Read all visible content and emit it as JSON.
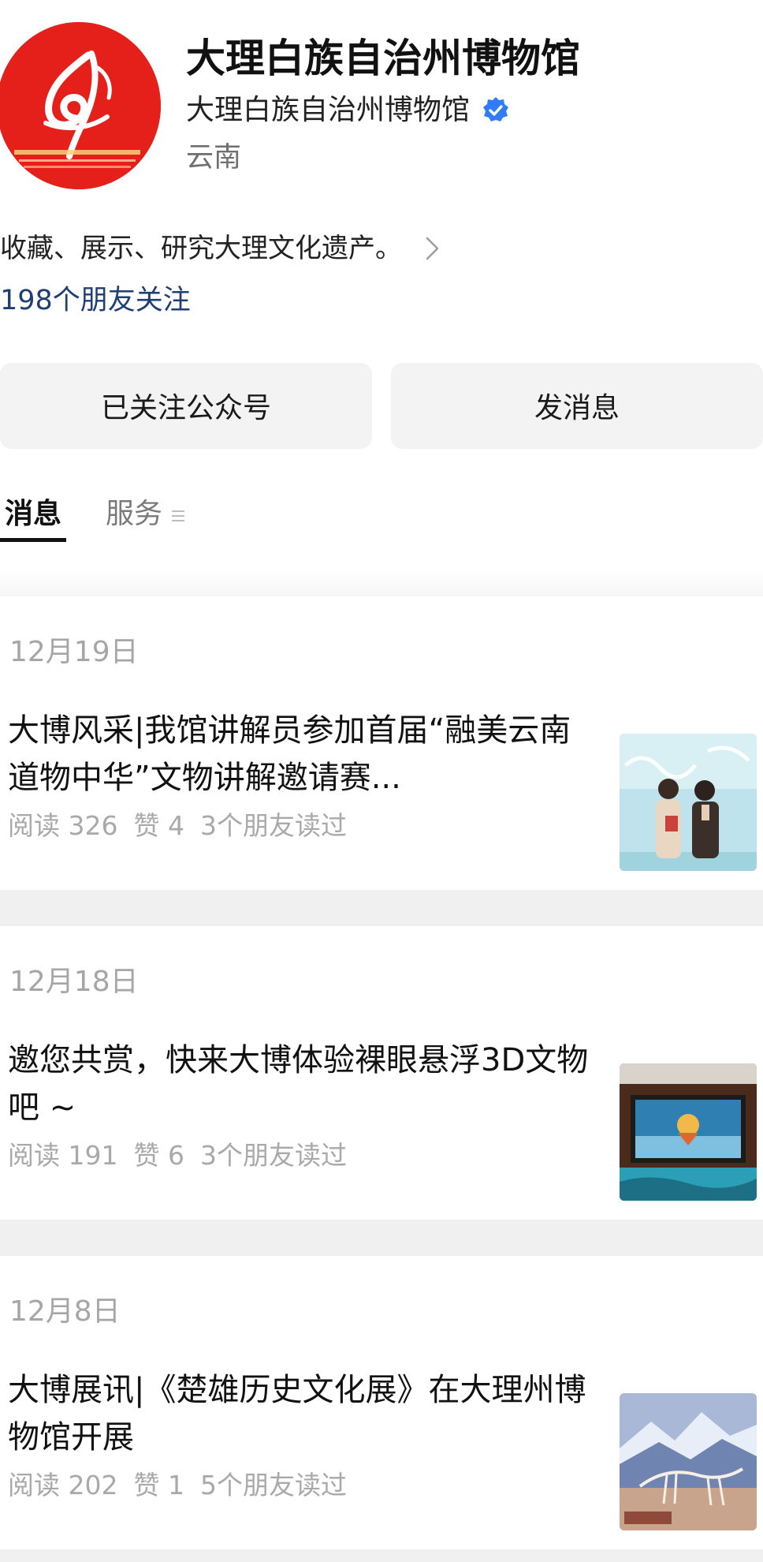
{
  "account": {
    "name": "大理白族自治州博物馆",
    "verified_name": "大理白族自治州博物馆",
    "region": "云南",
    "description": "收藏、展示、研究大理文化遗产。",
    "friends_following": "198个朋友关注"
  },
  "actions": {
    "follow_label": "已关注公众号",
    "message_label": "发消息"
  },
  "tabs": {
    "messages": "消息",
    "services": "服务"
  },
  "icons": {
    "logo": "museum-logo",
    "verified": "verified-badge-icon",
    "chevron": "chevron-right-icon",
    "services_menu": "menu-lines-icon"
  },
  "colors": {
    "logo_red": "#e5201a",
    "verified_blue": "#2f7cf6",
    "friends_link": "#1f3f73"
  },
  "articles": [
    {
      "date": "12月19日",
      "title": "大博风采|我馆讲解员参加首届“融美云南 道物中华”文物讲解邀请赛...",
      "reads": "阅读 326",
      "likes": "赞 4",
      "friends_read": "3个朋友读过"
    },
    {
      "date": "12月18日",
      "title": "邀您共赏，快来大博体验裸眼悬浮3D文物吧 ~",
      "reads": "阅读 191",
      "likes": "赞 6",
      "friends_read": "3个朋友读过"
    },
    {
      "date": "12月8日",
      "title": "大博展讯|《楚雄历史文化展》在大理州博物馆开展",
      "reads": "阅读 202",
      "likes": "赞 1",
      "friends_read": "5个朋友读过"
    }
  ]
}
